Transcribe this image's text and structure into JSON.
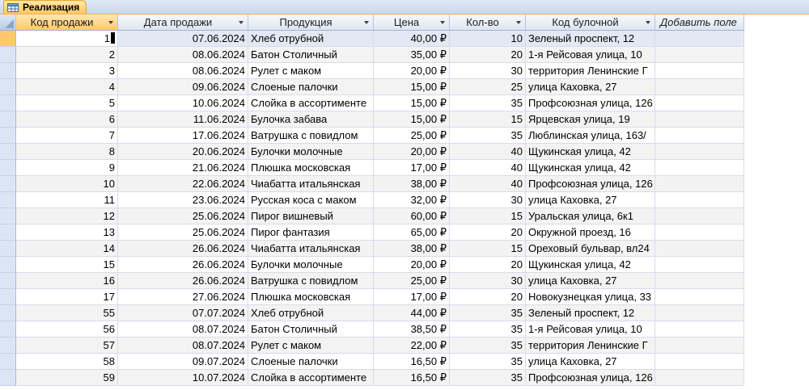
{
  "tab": {
    "title": "Реализация",
    "icon": "table-icon"
  },
  "columns": [
    {
      "label": "Код продажи",
      "dropdown": true
    },
    {
      "label": "Дата продажи",
      "dropdown": true
    },
    {
      "label": "Продукция",
      "dropdown": true
    },
    {
      "label": "Цена",
      "dropdown": true
    },
    {
      "label": "Кол-во",
      "dropdown": true
    },
    {
      "label": "Код булочной",
      "dropdown": true
    }
  ],
  "add_field_label": "Добавить поле",
  "rows": [
    {
      "id": "1",
      "date": "07.06.2024",
      "product": "Хлеб отрубной",
      "price": "40,00 ₽",
      "qty": "10",
      "bakery": "Зеленый проспект, 12"
    },
    {
      "id": "2",
      "date": "08.06.2024",
      "product": "Батон Столичный",
      "price": "35,00 ₽",
      "qty": "20",
      "bakery": "1-я Рейсовая улица, 10"
    },
    {
      "id": "3",
      "date": "08.06.2024",
      "product": "Рулет с маком",
      "price": "20,00 ₽",
      "qty": "30",
      "bakery": "территория Ленинские Г"
    },
    {
      "id": "4",
      "date": "09.06.2024",
      "product": "Слоеные палочки",
      "price": "15,00 ₽",
      "qty": "25",
      "bakery": "улица Каховка, 27"
    },
    {
      "id": "5",
      "date": "10.06.2024",
      "product": "Слойка в ассортименте",
      "price": "15,00 ₽",
      "qty": "35",
      "bakery": "Профсоюзная улица, 126"
    },
    {
      "id": "6",
      "date": "11.06.2024",
      "product": "Булочка забава",
      "price": "15,00 ₽",
      "qty": "15",
      "bakery": "Ярцевская улица, 19"
    },
    {
      "id": "7",
      "date": "17.06.2024",
      "product": "Ватрушка с повидлом",
      "price": "25,00 ₽",
      "qty": "35",
      "bakery": "Люблинская улица, 163/"
    },
    {
      "id": "8",
      "date": "20.06.2024",
      "product": "Булочки молочные",
      "price": "20,00 ₽",
      "qty": "40",
      "bakery": "Щукинская улица, 42"
    },
    {
      "id": "9",
      "date": "21.06.2024",
      "product": "Плюшка московская",
      "price": "17,00 ₽",
      "qty": "40",
      "bakery": "Щукинская улица, 42"
    },
    {
      "id": "10",
      "date": "22.06.2024",
      "product": "Чиабатта итальянская",
      "price": "38,00 ₽",
      "qty": "40",
      "bakery": "Профсоюзная улица, 126"
    },
    {
      "id": "11",
      "date": "23.06.2024",
      "product": "Русская коса с маком",
      "price": "32,00 ₽",
      "qty": "30",
      "bakery": "улица Каховка, 27"
    },
    {
      "id": "12",
      "date": "25.06.2024",
      "product": "Пирог вишневый",
      "price": "60,00 ₽",
      "qty": "15",
      "bakery": "Уральская улица, 6к1"
    },
    {
      "id": "13",
      "date": "25.06.2024",
      "product": "Пирог фантазия",
      "price": "65,00 ₽",
      "qty": "20",
      "bakery": "Окружной проезд, 16"
    },
    {
      "id": "14",
      "date": "26.06.2024",
      "product": "Чиабатта итальянская",
      "price": "38,00 ₽",
      "qty": "15",
      "bakery": "Ореховый бульвар, вл24"
    },
    {
      "id": "15",
      "date": "26.06.2024",
      "product": "Булочки молочные",
      "price": "20,00 ₽",
      "qty": "20",
      "bakery": "Щукинская улица, 42"
    },
    {
      "id": "16",
      "date": "26.06.2024",
      "product": "Ватрушка с повидлом",
      "price": "25,00 ₽",
      "qty": "30",
      "bakery": "улица Каховка, 27"
    },
    {
      "id": "17",
      "date": "27.06.2024",
      "product": "Плюшка московская",
      "price": "17,00 ₽",
      "qty": "20",
      "bakery": "Новокузнецкая улица, 33"
    },
    {
      "id": "55",
      "date": "07.07.2024",
      "product": "Хлеб отрубной",
      "price": "44,00 ₽",
      "qty": "35",
      "bakery": "Зеленый проспект, 12"
    },
    {
      "id": "56",
      "date": "08.07.2024",
      "product": "Батон Столичный",
      "price": "38,50 ₽",
      "qty": "35",
      "bakery": "1-я Рейсовая улица, 10"
    },
    {
      "id": "57",
      "date": "08.07.2024",
      "product": "Рулет с маком",
      "price": "22,00 ₽",
      "qty": "35",
      "bakery": "территория Ленинские Г"
    },
    {
      "id": "58",
      "date": "09.07.2024",
      "product": "Слоеные палочки",
      "price": "16,50 ₽",
      "qty": "35",
      "bakery": "улица Каховка, 27"
    },
    {
      "id": "59",
      "date": "10.07.2024",
      "product": "Слойка в ассортименте",
      "price": "16,50 ₽",
      "qty": "35",
      "bakery": "Профсоюзная улица, 126"
    }
  ],
  "selected_row_index": 0,
  "colors": {
    "tab_active": "#ffc760",
    "header_bg": "#dfe6f1",
    "selector_bg": "#dbe6f4",
    "row_alt": "#f3f3f3"
  }
}
